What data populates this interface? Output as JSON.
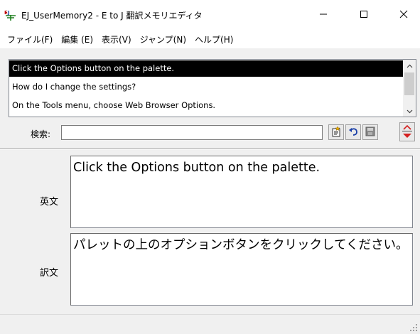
{
  "window": {
    "title": "EJ_UserMemory2 - E to J 翻訳メモリエディタ",
    "icon": "app-logo-icon",
    "controls": [
      "minimize-icon",
      "maximize-icon",
      "close-icon"
    ]
  },
  "menu": [
    {
      "label": "ファイル(F)"
    },
    {
      "label": "編集 (E)"
    },
    {
      "label": "表示(V)"
    },
    {
      "label": "ジャンプ(N)"
    },
    {
      "label": "ヘルプ(H)"
    }
  ],
  "list": {
    "rows": [
      {
        "text": "Click the Options button on the palette.",
        "selected": true
      },
      {
        "text": "How do I change the settings?",
        "selected": false
      },
      {
        "text": "On the Tools menu, choose Web Browser Options.",
        "selected": false
      }
    ]
  },
  "search": {
    "label": "検索:",
    "value": ""
  },
  "toolbar": [
    "add-entry-icon",
    "undo-icon",
    "save-icon",
    "prev-next-icon"
  ],
  "editor": {
    "english_label": "英文",
    "english_text": "Click the Options button on the palette.",
    "translation_label": "訳文",
    "translation_text": "パレットの上のオプションボタンをクリックしてください。"
  },
  "colors": {
    "selection_bg": "#000000",
    "panel_bg": "#f0f0f0",
    "accent_red": "#d42020"
  }
}
